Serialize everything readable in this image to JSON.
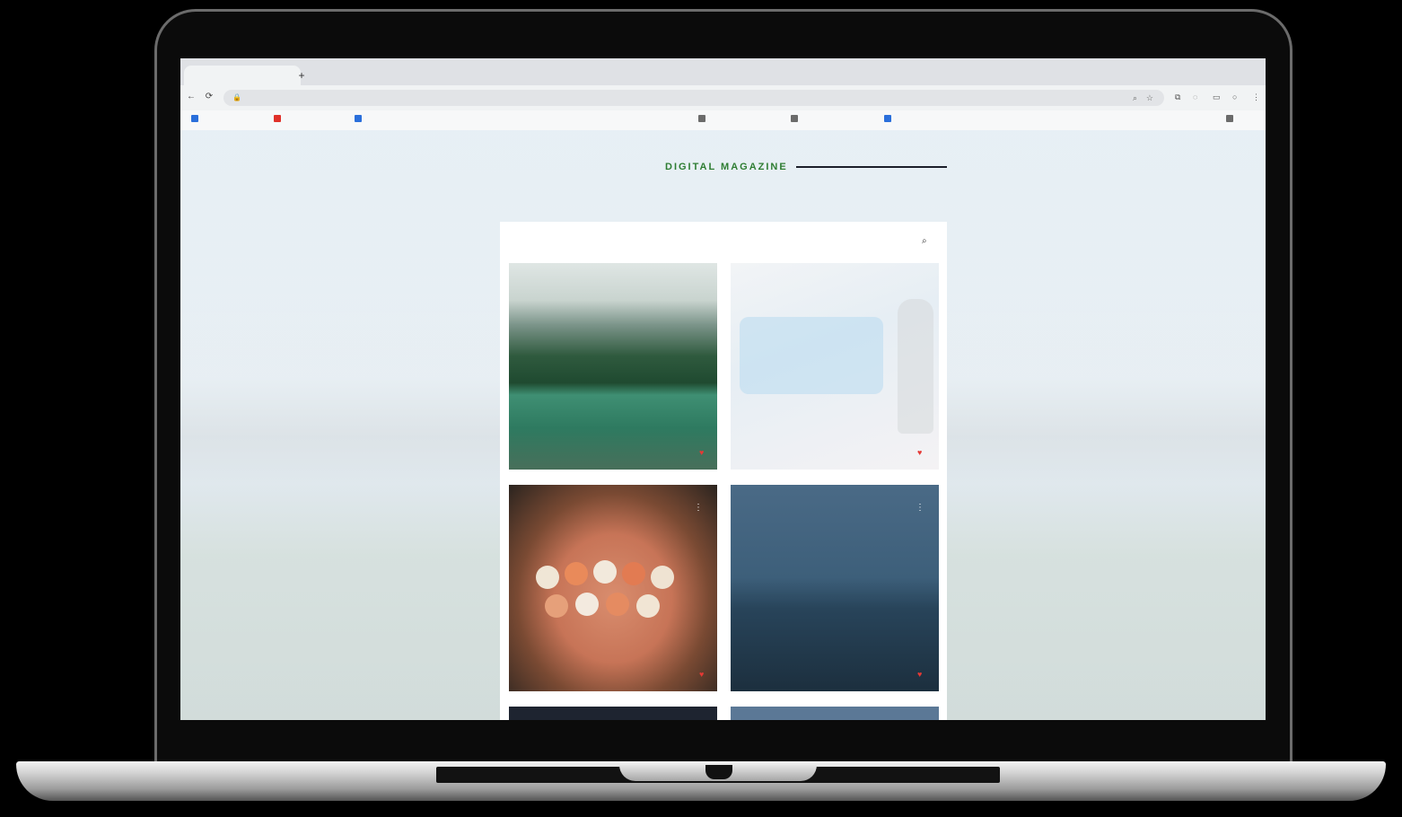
{
  "magazine": {
    "title": "DIGITAL MAGAZINE",
    "subtitle": ""
  },
  "browser": {
    "tab_title": "",
    "new_tab_glyph": "+",
    "address": ""
  },
  "bookmarks": [
    "",
    "",
    "",
    "",
    "",
    "",
    "",
    "",
    "",
    "",
    ""
  ],
  "filters": [
    "",
    "",
    "",
    "",
    "",
    "",
    ""
  ],
  "posts": [
    {
      "title": "",
      "meta": "",
      "image": "mountain-lake"
    },
    {
      "title": "",
      "meta": "",
      "image": "face-masks"
    },
    {
      "title": "",
      "meta": "",
      "author": "",
      "image": "sushi-platter"
    },
    {
      "title": "",
      "meta": "",
      "author": "",
      "image": "city-at-night"
    }
  ],
  "colors": {
    "accent_green": "#2e7d32",
    "heart_red": "#e53935",
    "title_rule": "#1c1f2a"
  }
}
